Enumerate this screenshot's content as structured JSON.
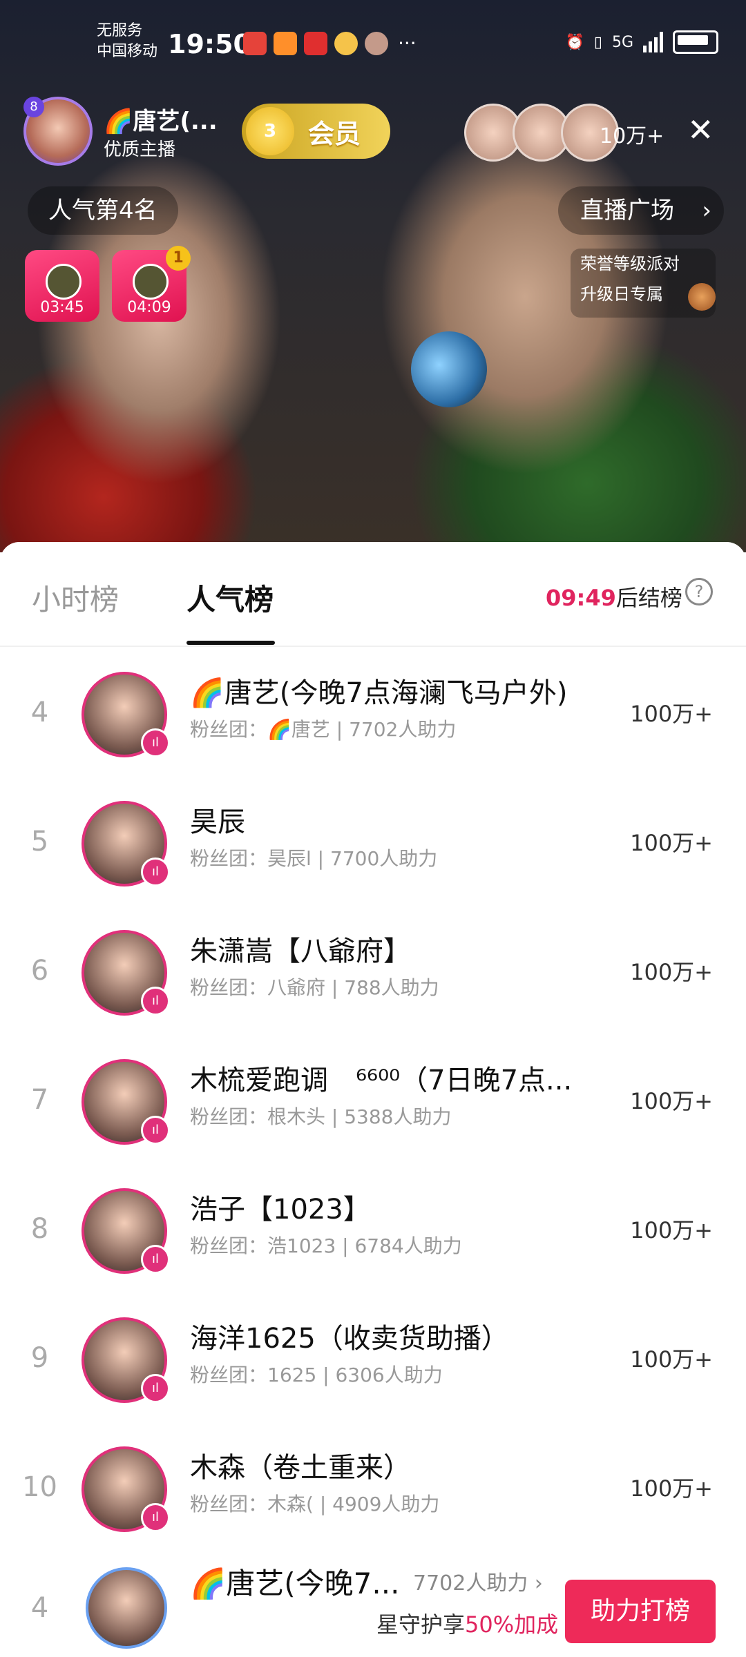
{
  "status_bar": {
    "carrier_line1": "无服务",
    "carrier_line2": "中国移动",
    "time": "19:50",
    "more": "···",
    "network": "5G"
  },
  "live_header": {
    "host_name": "🌈唐艺(...",
    "host_tag": "优质主播",
    "fans_level": "3",
    "vip_label": "会员",
    "viewer_count": "10万+",
    "close_icon": "close-icon",
    "popularity_rank": "人气第4名",
    "plaza_label": "直播广场",
    "plaza_chevron": "›",
    "promo_line1": "荣誉等级派对",
    "promo_line2": "升级日专属"
  },
  "gifts": [
    {
      "time": "03:45"
    },
    {
      "time": "04:09",
      "badge": "1"
    }
  ],
  "rank_panel": {
    "tab_hourly": "小时榜",
    "tab_popular": "人气榜",
    "countdown": "09:49",
    "countdown_suffix": "后结榜",
    "help": "?"
  },
  "rows": [
    {
      "rank": "4",
      "name": "🌈唐艺(今晚7点海澜飞马户外)",
      "sub": "粉丝团：🌈唐艺 | 7702人助力",
      "value": "100万+"
    },
    {
      "rank": "5",
      "name": "昊辰",
      "sub": "粉丝团：昊辰l | 7700人助力",
      "value": "100万+"
    },
    {
      "rank": "6",
      "name": "朱潇嵩【八爺府】",
      "sub": "粉丝团：八爺府 | 788人助力",
      "value": "100万+"
    },
    {
      "rank": "7",
      "name": "木梳爱跑调　⁶⁶⁰⁰（7日晚7点...",
      "sub": "粉丝团：根木头 | 5388人助力",
      "value": "100万+"
    },
    {
      "rank": "8",
      "name": "浩子【1023】",
      "sub": "粉丝团：浩1023 | 6784人助力",
      "value": "100万+"
    },
    {
      "rank": "9",
      "name": "海洋1625（收卖货助播）",
      "sub": "粉丝团：1625 | 6306人助力",
      "value": "100万+"
    },
    {
      "rank": "10",
      "name": "木森（卷土重来）",
      "sub": "粉丝团：木森( | 4909人助力",
      "value": "100万+"
    }
  ],
  "footer": {
    "rank": "4",
    "name": "🌈唐艺(今晚7...",
    "support": "7702人助力 ›",
    "tip_prefix": "星守护享",
    "tip_highlight": "50%加成",
    "boost_button": "助力打榜"
  },
  "colors": {
    "accent": "#e0245e",
    "boost_button": "#ee2a59",
    "rank_gray": "#aaaaaa"
  }
}
